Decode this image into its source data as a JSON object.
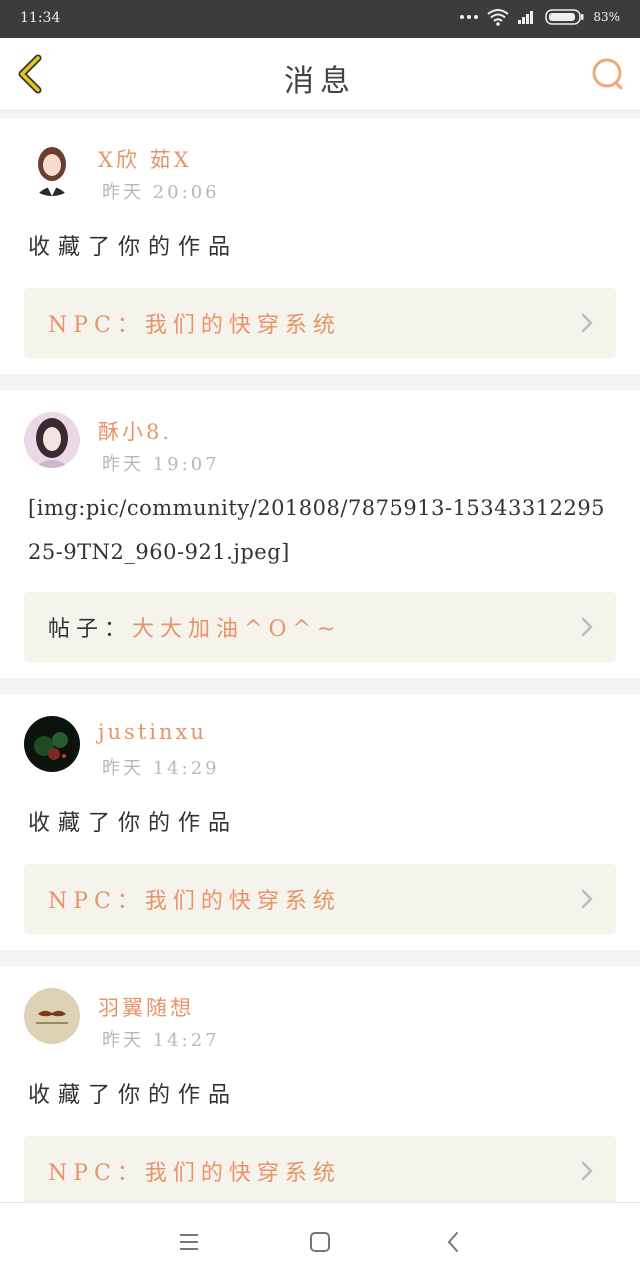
{
  "status": {
    "time": "11:34",
    "battery": "83%",
    "icons": [
      "dots-icon",
      "wifi-icon",
      "signal-icon",
      "battery-icon"
    ]
  },
  "header": {
    "title": "消息",
    "back_icon": "chevron-left-icon",
    "search_icon": "search-icon"
  },
  "colors": {
    "accent": "#e8936a",
    "back_arrow": "#e0c020",
    "quote_bg": "#f4f3ec"
  },
  "messages": [
    {
      "username": "X欣 茹X",
      "time": "昨天 20:06",
      "text": "收藏了你的作品",
      "quote_prefix": "",
      "quote_work": "NPC：我们的快穿系统"
    },
    {
      "username": "酥小8.",
      "time": "昨天 19:07",
      "text": "[img:pic/community/201808/7875913-1534331229525-9TN2_960-921.jpeg]",
      "quote_prefix": "帖子：",
      "quote_work": "大大加油^O^~"
    },
    {
      "username": "justinxu",
      "time": "昨天 14:29",
      "text": "收藏了你的作品",
      "quote_prefix": "",
      "quote_work": "NPC：我们的快穿系统"
    },
    {
      "username": "羽翼随想",
      "time": "昨天 14:27",
      "text": "收藏了你的作品",
      "quote_prefix": "",
      "quote_work": "NPC：我们的快穿系统"
    }
  ],
  "bottom_nav": [
    "menu-icon",
    "home-square-icon",
    "back-triangle-icon"
  ]
}
